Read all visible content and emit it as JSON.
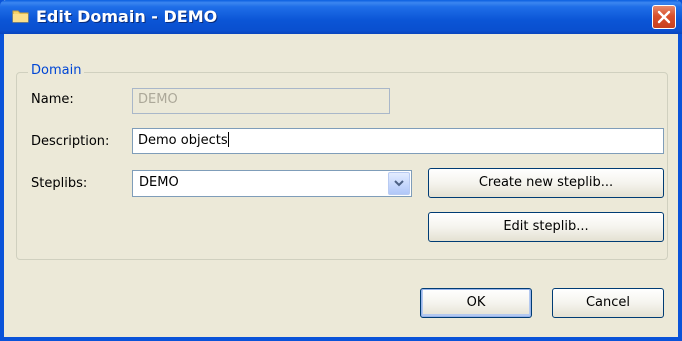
{
  "window": {
    "title": "Edit Domain - DEMO",
    "icon": "folder-icon"
  },
  "group": {
    "legend": "Domain"
  },
  "fields": {
    "name_label": "Name:",
    "name_value": "DEMO",
    "description_label": "Description:",
    "description_value": "Demo objects",
    "steplibs_label": "Steplibs:",
    "steplibs_value": "DEMO"
  },
  "buttons": {
    "create_steplib": "Create new steplib...",
    "edit_steplib": "Edit steplib...",
    "ok": "OK",
    "cancel": "Cancel"
  },
  "colors": {
    "titlebar": "#0a55d6",
    "legend": "#0046d5",
    "close": "#d9502c"
  }
}
